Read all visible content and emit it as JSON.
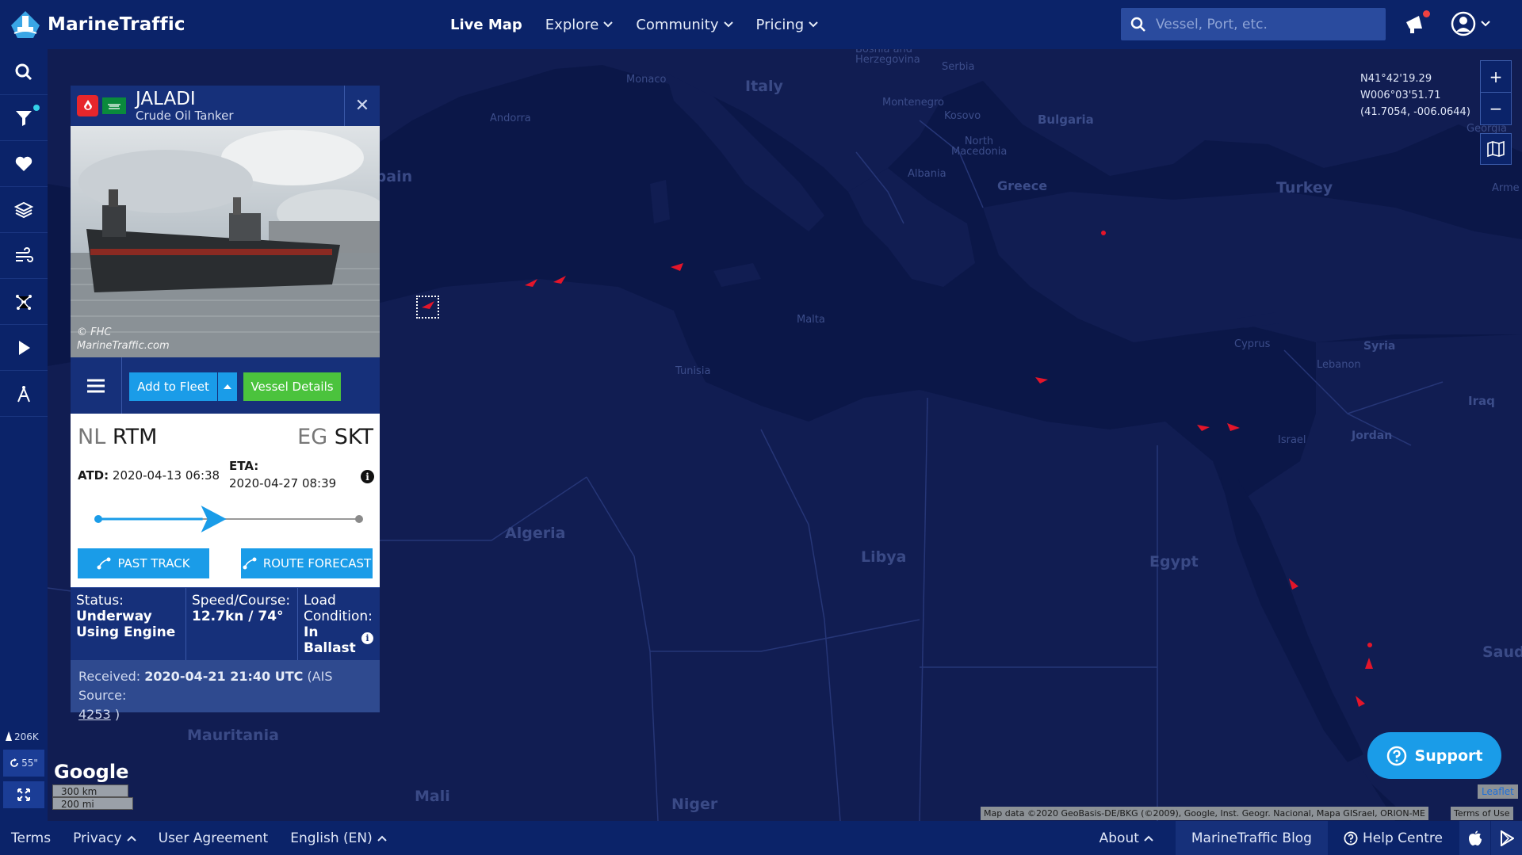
{
  "brand": {
    "name": "MarineTraffic"
  },
  "nav": {
    "live_map": "Live Map",
    "explore": "Explore",
    "community": "Community",
    "pricing": "Pricing"
  },
  "search": {
    "placeholder": "Vessel, Port, etc."
  },
  "sidebar": {
    "vessel_count": "206K",
    "refresh": "55\""
  },
  "map": {
    "coordinates": {
      "lat_dms": "N41°42'19.29",
      "lon_dms": "W006°03'51.71",
      "decimal": "(41.7054, -006.0644)"
    },
    "zoom_in": "+",
    "zoom_out": "−",
    "labels": {
      "italy": "Italy",
      "spain": "Spain",
      "greece": "Greece",
      "turkey": "Turkey",
      "bulgaria": "Bulgaria",
      "serbia": "Serbia",
      "bosnia": "Bosnia and Herzegovina",
      "monaco": "Monaco",
      "andorra": "Andorra",
      "montenegro": "Montenegro",
      "kosovo": "Kosovo",
      "north_macedonia": "North Macedonia",
      "albania": "Albania",
      "malta": "Malta",
      "tunisia": "Tunisia",
      "cyprus": "Cyprus",
      "lebanon": "Lebanon",
      "syria": "Syria",
      "israel": "Israel",
      "jordan": "Jordan",
      "iraq": "Iraq",
      "algeria": "Algeria",
      "libya": "Libya",
      "egypt": "Egypt",
      "mauritania": "Mauritania",
      "mali": "Mali",
      "niger": "Niger",
      "georgia": "Georgia",
      "armenia": "Arme",
      "saudi": "Saud"
    },
    "google": "Google",
    "scale_km": "300 km",
    "scale_mi": "200 mi",
    "attribution": "Map data ©2020 GeoBasis-DE/BKG (©2009), Google, Inst. Geogr. Nacional, Mapa GISrael, ORION-ME",
    "terms_of_use": "Terms of Use",
    "leaflet": "Leaflet"
  },
  "vessel": {
    "name": "JALADI",
    "type": "Crude Oil Tanker",
    "photo_credit_1": "© FHC",
    "photo_credit_2": "MarineTraffic.com",
    "add_to_fleet": "Add to Fleet",
    "vessel_details": "Vessel Details",
    "origin_cc": "NL",
    "origin_port": "RTM",
    "dest_cc": "EG",
    "dest_port": "SKT",
    "atd_label": "ATD:",
    "atd_value": "2020-04-13 06:38",
    "eta_label": "ETA:",
    "eta_value": "2020-04-27 08:39",
    "past_track": "PAST TRACK",
    "route_forecast": "ROUTE FORECAST",
    "status_label": "Status:",
    "status_value": "Underway Using Engine",
    "speed_label": "Speed/Course:",
    "speed_value": "12.7kn / 74°",
    "load_label": "Load Condition:",
    "load_value": "In Ballast",
    "received_label": "Received:",
    "received_value": "2020-04-21 21:40 UTC",
    "ais_prefix": "(AIS Source:",
    "ais_source": "4253",
    "ais_suffix": ")",
    "voyage_progress": 0.4
  },
  "support": {
    "label": "Support"
  },
  "footer": {
    "terms": "Terms",
    "privacy": "Privacy",
    "user_agreement": "User Agreement",
    "language": "English (EN)",
    "about": "About",
    "blog": "MarineTraffic Blog",
    "help": "Help Centre"
  },
  "colors": {
    "nav_bg": "#0b2369",
    "map_water": "#0b1748",
    "accent_blue": "#1a9ce8",
    "accent_green": "#4bc33d",
    "vessel_red": "#e4152a"
  }
}
